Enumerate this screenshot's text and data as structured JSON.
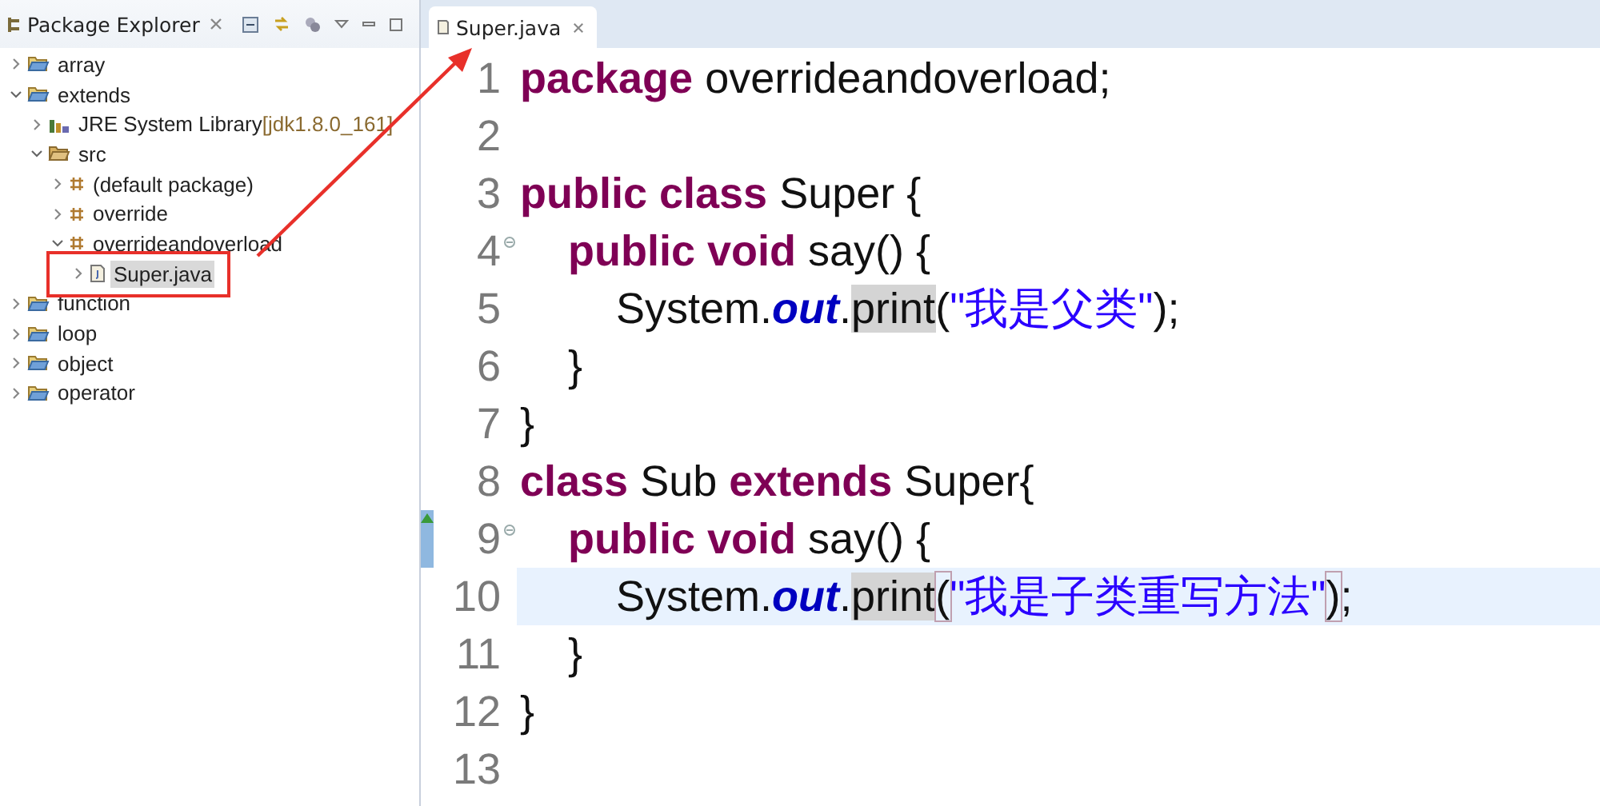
{
  "explorer": {
    "title": "Package Explorer",
    "tree": [
      {
        "label": "array",
        "kind": "project",
        "expanded": false,
        "selected": false
      },
      {
        "label": "extends",
        "kind": "project",
        "expanded": true,
        "selected": false,
        "children": [
          {
            "label": "JRE System Library",
            "decoration": "[jdk1.8.0_161]",
            "kind": "library",
            "expanded": false,
            "selected": false
          },
          {
            "label": "src",
            "kind": "source-folder",
            "expanded": true,
            "selected": false,
            "children": [
              {
                "label": "(default package)",
                "kind": "package",
                "expanded": false,
                "selected": false
              },
              {
                "label": "override",
                "kind": "package",
                "expanded": false,
                "selected": false
              },
              {
                "label": "overrideandoverload",
                "kind": "package",
                "expanded": true,
                "selected": false,
                "children": [
                  {
                    "label": "Super.java",
                    "kind": "java-file",
                    "expanded": false,
                    "selected": true
                  }
                ]
              }
            ]
          }
        ]
      },
      {
        "label": "function",
        "kind": "project",
        "expanded": false,
        "selected": false
      },
      {
        "label": "loop",
        "kind": "project",
        "expanded": false,
        "selected": false
      },
      {
        "label": "object",
        "kind": "project",
        "expanded": false,
        "selected": false
      },
      {
        "label": "operator",
        "kind": "project",
        "expanded": false,
        "selected": false
      }
    ]
  },
  "editor": {
    "tab": {
      "label": "Super.java",
      "selected": true
    },
    "lines": [
      {
        "number": "1",
        "current": false,
        "fold": false,
        "override": false,
        "tokens": [
          {
            "text": "package",
            "kind": "keyword"
          },
          {
            "text": " overrideandoverload;",
            "kind": "plain"
          }
        ]
      },
      {
        "number": "2",
        "current": false,
        "fold": false,
        "override": false
      },
      {
        "number": "3",
        "current": false,
        "fold": false,
        "override": false,
        "tokens": [
          {
            "text": "public class",
            "kind": "keyword"
          },
          {
            "text": " Super {",
            "kind": "plain"
          }
        ]
      },
      {
        "number": "4",
        "current": false,
        "fold": true,
        "override": false,
        "tokens": [
          {
            "text": "    public void",
            "kind": "keyword"
          },
          {
            "text": " say() {",
            "kind": "plain"
          }
        ]
      },
      {
        "number": "5",
        "current": false,
        "fold": false,
        "override": false,
        "tokens": [
          {
            "text": "        System.",
            "kind": "plain"
          },
          {
            "text": "out",
            "kind": "field"
          },
          {
            "text": ".",
            "kind": "plain"
          },
          {
            "text": "print",
            "kind": "occurrence"
          },
          {
            "text": "(",
            "kind": "plain"
          },
          {
            "text": "\"我是父类\"",
            "kind": "string"
          },
          {
            "text": ");",
            "kind": "plain"
          }
        ]
      },
      {
        "number": "6",
        "current": false,
        "fold": false,
        "override": false,
        "tokens": [
          {
            "text": "    }",
            "kind": "plain"
          }
        ]
      },
      {
        "number": "7",
        "current": false,
        "fold": false,
        "override": false,
        "tokens": [
          {
            "text": "}",
            "kind": "plain"
          }
        ]
      },
      {
        "number": "8",
        "current": false,
        "fold": false,
        "override": false,
        "tokens": [
          {
            "text": "class",
            "kind": "keyword"
          },
          {
            "text": " Sub ",
            "kind": "plain"
          },
          {
            "text": "extends",
            "kind": "keyword"
          },
          {
            "text": " Super{",
            "kind": "plain"
          }
        ]
      },
      {
        "number": "9",
        "current": false,
        "fold": true,
        "override": true,
        "tokens": [
          {
            "text": "    public void",
            "kind": "keyword"
          },
          {
            "text": " say() {",
            "kind": "plain"
          }
        ]
      },
      {
        "number": "10",
        "current": true,
        "fold": false,
        "override": false,
        "tokens": [
          {
            "text": "        System.",
            "kind": "plain"
          },
          {
            "text": "out",
            "kind": "field"
          },
          {
            "text": ".",
            "kind": "plain"
          },
          {
            "text": "print",
            "kind": "occurrence"
          },
          {
            "text": "(",
            "kind": "bracket"
          },
          {
            "text": "\"我是子类重写方法\"",
            "kind": "string"
          },
          {
            "text": ")",
            "kind": "bracket"
          },
          {
            "text": ";",
            "kind": "plain"
          }
        ]
      },
      {
        "number": "11",
        "current": false,
        "fold": false,
        "override": false,
        "tokens": [
          {
            "text": "    }",
            "kind": "plain"
          }
        ]
      },
      {
        "number": "12",
        "current": false,
        "fold": false,
        "override": false,
        "tokens": [
          {
            "text": "}",
            "kind": "plain"
          }
        ]
      },
      {
        "number": "13",
        "current": false,
        "fold": false,
        "override": false
      }
    ]
  }
}
